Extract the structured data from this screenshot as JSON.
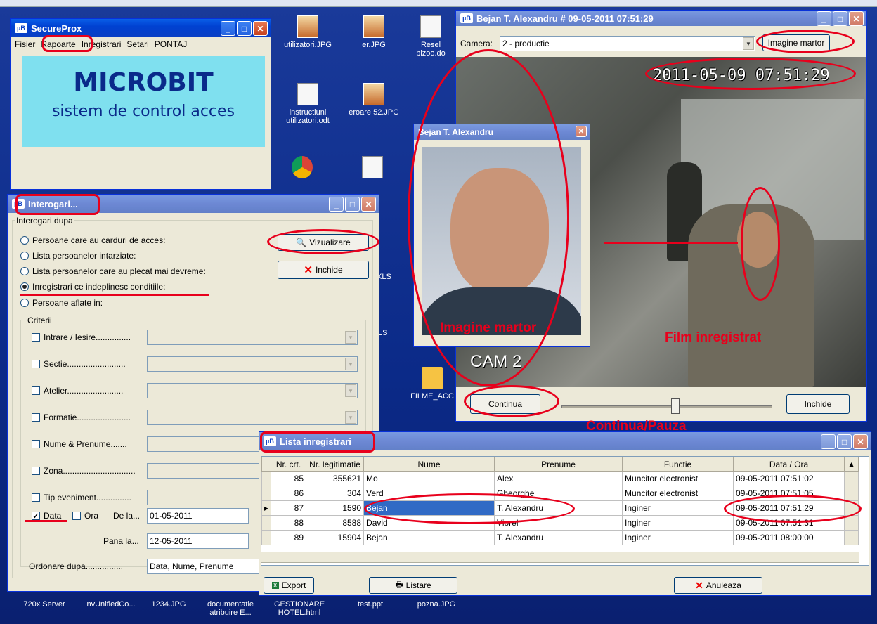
{
  "secureprox": {
    "title": "SecureProx",
    "icon": "µB",
    "menu": [
      "Fisier",
      "Rapoarte",
      "Inregistrari",
      "Setari",
      "PONTAJ"
    ],
    "brand": "MICROBIT",
    "tagline": "sistem de control acces",
    "banner_color": "#7fe0ef"
  },
  "desktop_icons": [
    {
      "label": "utilizatori.JPG",
      "type": "jpg"
    },
    {
      "label": "er.JPG",
      "type": "jpg"
    },
    {
      "label": "Resel bizoo.do",
      "type": "doc"
    },
    {
      "label": "instructiuni utilizatori.odt",
      "type": "doc"
    },
    {
      "label": "eroare 52.JPG",
      "type": "jpg"
    },
    {
      "label": "FILME_ACC",
      "type": "folder"
    }
  ],
  "interogari": {
    "title": "Interogari...",
    "group_label": "Interogari dupa",
    "options": [
      {
        "label": "Persoane care au carduri de acces:",
        "checked": false
      },
      {
        "label": "Lista persoanelor intarziate:",
        "checked": false
      },
      {
        "label": "Lista persoanelor care au plecat mai devreme:",
        "checked": false
      },
      {
        "label": "Inregistrari ce indeplinesc conditiile:",
        "checked": true
      },
      {
        "label": "Persoane aflate in:",
        "checked": false
      }
    ],
    "btn_view": "Vizualizare",
    "btn_close": "Inchide",
    "criteria_label": "Criterii",
    "criteria": [
      "Intrare / Iesire...............",
      "Sectie.........................",
      "Atelier........................",
      "Formatie.......................",
      "Nume & Prenume.......",
      "Zona...............................",
      "Tip eveniment..............."
    ],
    "data_label": "Data",
    "ora_label": "Ora",
    "de_la_label": "De la...",
    "de_la_value": "01-05-2011",
    "pana_la_label": "Pana la...",
    "pana_la_value": "12-05-2011",
    "order_label": "Ordonare dupa................",
    "order_value": "Data, Nume, Prenume"
  },
  "video": {
    "title": "Bejan T. Alexandru # 09-05-2011 07:51:29",
    "camera_label": "Camera:",
    "camera_value": "2 - productie",
    "btn_witness": "Imagine martor",
    "timestamp": "2011-05-09  07:51:29",
    "cam_label": "CAM 2",
    "btn_continue": "Continua",
    "btn_close": "Inchide"
  },
  "photo_window": {
    "title": "Bejan T. Alexandru"
  },
  "annotations": {
    "witness": "Imagine martor",
    "recorded": "Film inregistrat",
    "pause": "Continua/Pauza"
  },
  "records": {
    "title": "Lista inregistrari",
    "columns": [
      "Nr. crt.",
      "Nr. legitimatie",
      "Nume",
      "Prenume",
      "Functie",
      "Data / Ora"
    ],
    "rows": [
      [
        "85",
        "355621",
        "Mo",
        "Alex",
        "Muncitor electronist",
        "09-05-2011 07:51:02"
      ],
      [
        "86",
        "304",
        "Verd",
        "Gheorghe",
        "Muncitor electronist",
        "09-05-2011 07:51:05"
      ],
      [
        "87",
        "1590",
        "Bejan",
        "T. Alexandru",
        "Inginer",
        "09-05-2011 07:51:29"
      ],
      [
        "88",
        "8588",
        "David",
        "Viorel",
        "Inginer",
        "09-05-2011 07:51:31"
      ],
      [
        "89",
        "15904",
        "Bejan",
        "T. Alexandru",
        "Inginer",
        "09-05-2011 08:00:00"
      ]
    ],
    "selected_row": 2,
    "btn_export": "Export",
    "btn_print": "Listare",
    "btn_cancel": "Anuleaza"
  },
  "taskbar_items": [
    "720x Server",
    "nvUnifiedCo...",
    "1234.JPG",
    "documentatie atribuire E...",
    "GESTIONARE HOTEL.html",
    "test.ppt",
    "pozna.JPG"
  ],
  "stray_labels": [
    "LS",
    "LS",
    "XLS",
    "m"
  ]
}
